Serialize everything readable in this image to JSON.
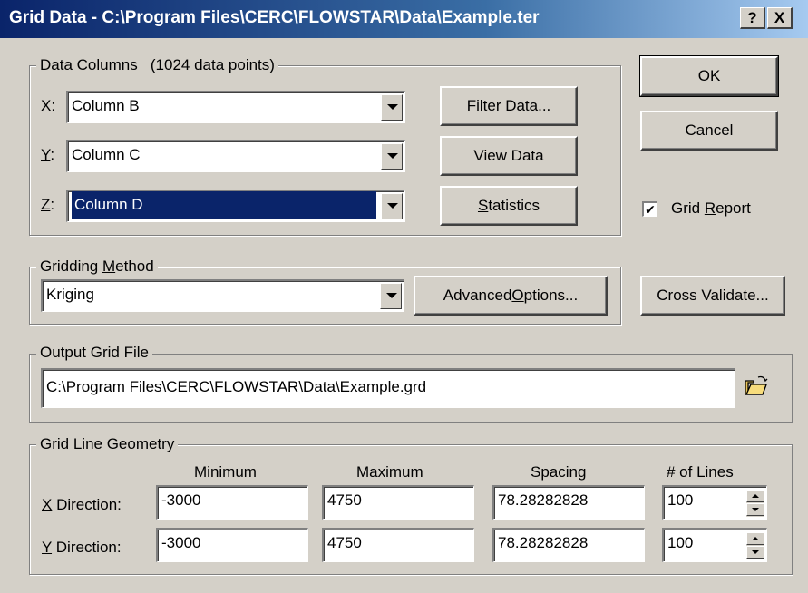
{
  "title": "Grid Data - C:\\Program Files\\CERC\\FLOWSTAR\\Data\\Example.ter",
  "titlebar_buttons": {
    "help": "?",
    "close": "X"
  },
  "data_columns": {
    "label": "Data Columns",
    "count_text": "(1024 data points)",
    "x": {
      "label_key": "X",
      "label_rest": ":",
      "value": "Column B"
    },
    "y": {
      "label_key": "Y",
      "label_rest": ":",
      "value": "Column C"
    },
    "z": {
      "label_key": "Z",
      "label_rest": ":",
      "value": "Column D"
    },
    "filter_button": "Filter Data...",
    "view_button": "View Data",
    "statistics_key": "S",
    "statistics_rest": "tatistics"
  },
  "buttons": {
    "ok": "OK",
    "cancel": "Cancel",
    "cross_validate": "Cross Validate..."
  },
  "grid_report": {
    "checked": true,
    "check_mark": "✔",
    "label_pre": "Grid ",
    "label_key": "R",
    "label_post": "eport"
  },
  "gridding": {
    "label_pre": "Gridding ",
    "label_key": "M",
    "label_post": "ethod",
    "method": "Kriging",
    "advanced_pre": "Advanced ",
    "advanced_key": "O",
    "advanced_post": "ptions..."
  },
  "output": {
    "label": "Output Grid File",
    "path": "C:\\Program Files\\CERC\\FLOWSTAR\\Data\\Example.grd",
    "browse_icon": "open-folder-icon"
  },
  "geometry": {
    "label": "Grid Line Geometry",
    "headers": {
      "min": "Minimum",
      "max": "Maximum",
      "spacing": "Spacing",
      "lines": "# of Lines"
    },
    "x": {
      "label_key": "X",
      "label_rest": " Direction:",
      "min": "-3000",
      "max": "4750",
      "spacing": "78.28282828",
      "lines": "100"
    },
    "y": {
      "label_key": "Y",
      "label_rest": " Direction:",
      "min": "-3000",
      "max": "4750",
      "spacing": "78.28282828",
      "lines": "100"
    }
  },
  "colors": {
    "face": "#d4d0c8",
    "title_start": "#0a246a",
    "title_end": "#a6caf0",
    "selection": "#0a246a"
  }
}
